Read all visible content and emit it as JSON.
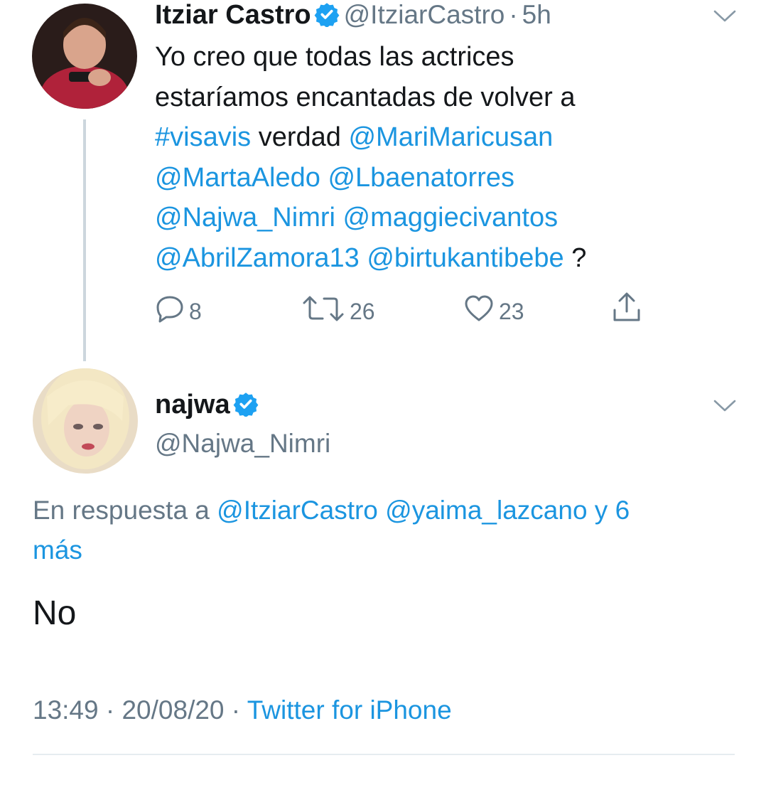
{
  "tweet1": {
    "name": "Itziar Castro",
    "handle": "@ItziarCastro",
    "separator": "·",
    "time": "5h",
    "text_plain_1": "Yo creo que todas las actrices",
    "text_plain_2": "estaríamos encantadas de volver a",
    "hashtag": "#visavis",
    "text_plain_3": "verdad",
    "mentions": [
      "@MariMaricusan",
      "@MartaAledo",
      "@Lbaenatorres",
      "@Najwa_Nimri",
      "@maggiecivantos",
      "@AbrilZamora13",
      "@birtukantibebe"
    ],
    "text_end": "?",
    "actions": {
      "replies": "8",
      "retweets": "26",
      "likes": "23"
    }
  },
  "tweet2": {
    "name": "najwa",
    "handle": "@Najwa_Nimri",
    "reply_prefix": "En respuesta a",
    "reply_to": "@ItziarCastro @yaima_lazcano y 6",
    "reply_more": "más",
    "text": "No",
    "timestamp_time": "13:49",
    "timestamp_date": "20/08/20",
    "separator": "·",
    "source": "Twitter for iPhone"
  },
  "icons": [
    "verified-badge-icon",
    "chevron-down-icon",
    "reply-icon",
    "retweet-icon",
    "like-icon",
    "share-icon"
  ],
  "colors": {
    "link": "#1b95e0",
    "verified": "#1da1f2",
    "muted": "#657786",
    "thread_line": "#ccd6dd"
  }
}
